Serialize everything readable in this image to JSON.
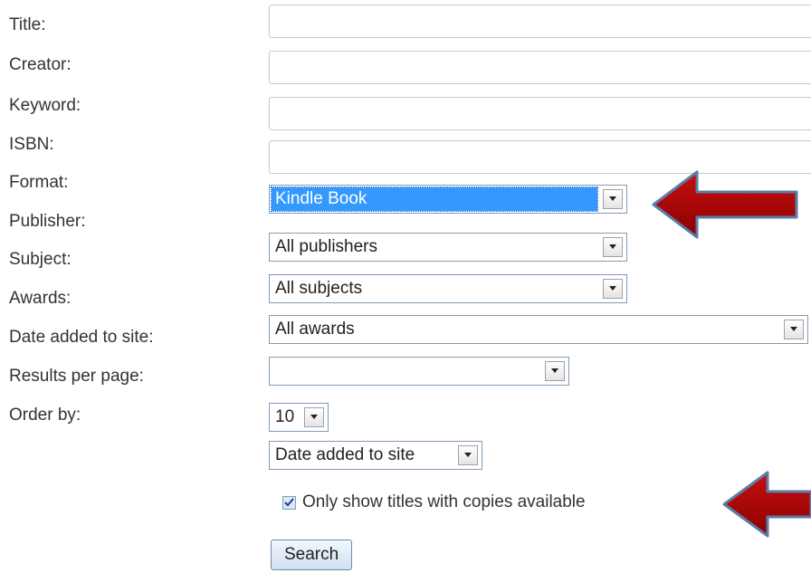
{
  "form": {
    "labels": {
      "title": "Title:",
      "creator": "Creator:",
      "keyword": "Keyword:",
      "isbn": "ISBN:",
      "format": "Format:",
      "publisher": "Publisher:",
      "subject": "Subject:",
      "awards": "Awards:",
      "date_added": "Date added to site:",
      "results_per_page": "Results per page:",
      "order_by": "Order by:"
    },
    "inputs": {
      "title": "",
      "creator": "",
      "keyword": "",
      "isbn": ""
    },
    "selects": {
      "format": "Kindle Book",
      "publisher": "All publishers",
      "subject": "All subjects",
      "awards": "All awards",
      "date_added": "",
      "results_per_page": "10",
      "order_by": "Date added to site"
    },
    "checkbox": {
      "label": "Only show titles with copies available",
      "checked": true
    },
    "search_button": "Search"
  },
  "annotations": {
    "arrow_color": "#b30000"
  },
  "icons": [
    "chevron-down-icon",
    "checkmark-icon",
    "arrow-left-icon"
  ]
}
